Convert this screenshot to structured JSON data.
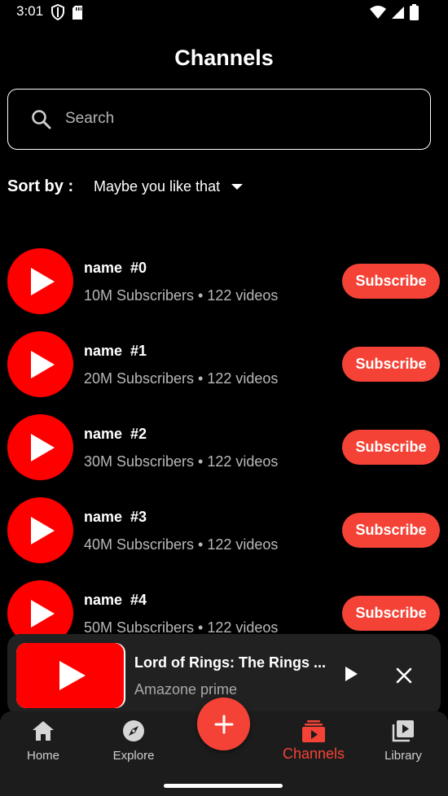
{
  "status_bar": {
    "time": "3:01"
  },
  "header": {
    "title": "Channels"
  },
  "search": {
    "placeholder": "Search"
  },
  "sort": {
    "label": "Sort by :",
    "selected": "Maybe you like that"
  },
  "channels": [
    {
      "name": "name  #0",
      "meta": "10M Subscribers • 122 videos",
      "button": "Subscribe"
    },
    {
      "name": "name  #1",
      "meta": "20M Subscribers • 122 videos",
      "button": "Subscribe"
    },
    {
      "name": "name  #2",
      "meta": "30M Subscribers • 122 videos",
      "button": "Subscribe"
    },
    {
      "name": "name  #3",
      "meta": "40M Subscribers • 122 videos",
      "button": "Subscribe"
    },
    {
      "name": "name  #4",
      "meta": "50M Subscribers • 122 videos",
      "button": "Subscribe"
    }
  ],
  "mini_player": {
    "title": "Lord of Rings: The Rings ...",
    "subtitle": "Amazone prime"
  },
  "bottom_nav": {
    "items": [
      {
        "label": "Home",
        "icon": "home-icon"
      },
      {
        "label": "Explore",
        "icon": "compass-icon"
      },
      {
        "label": "Channels",
        "icon": "subscriptions-icon",
        "active": true
      },
      {
        "label": "Library",
        "icon": "library-icon"
      }
    ]
  },
  "colors": {
    "accent": "#f44336",
    "brand_red": "#ff0000",
    "background": "#000000"
  }
}
